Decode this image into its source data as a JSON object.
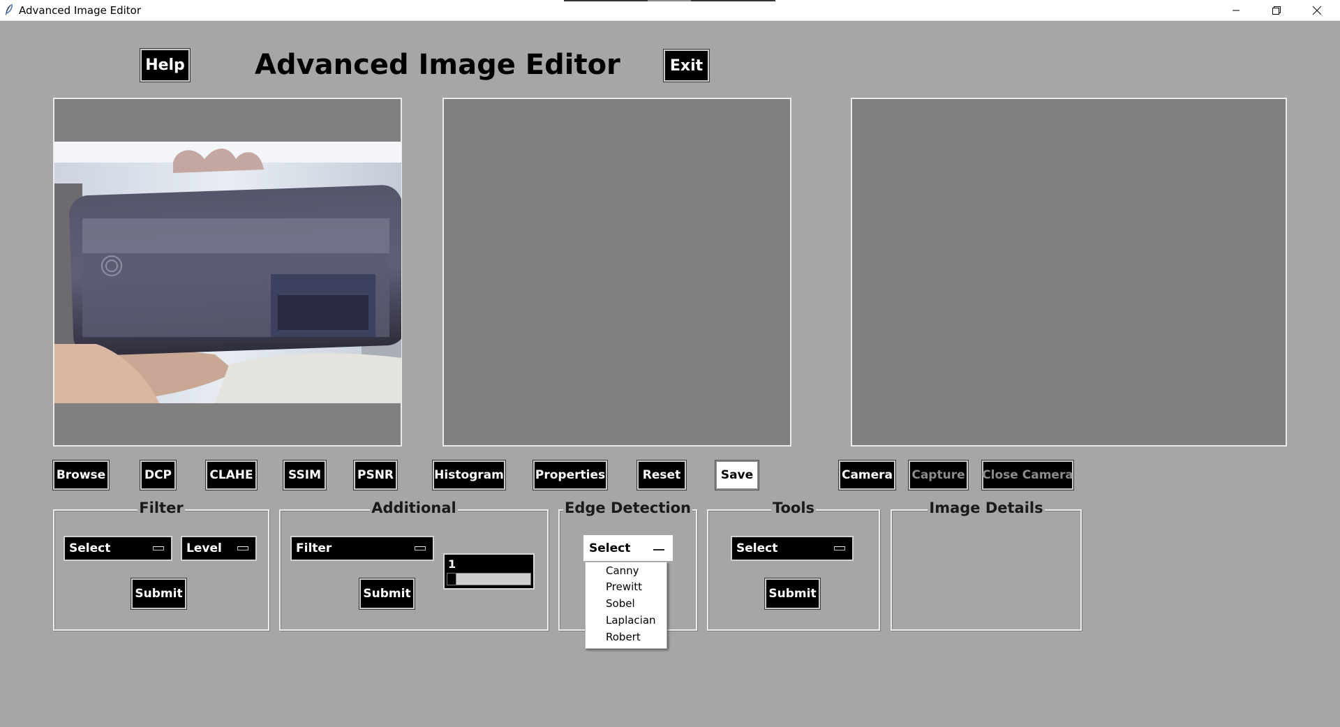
{
  "window": {
    "title": "Advanced Image Editor",
    "controls": [
      "minimize-icon",
      "restore-icon",
      "close-icon"
    ]
  },
  "header": {
    "help_label": "Help",
    "title": "Advanced Image Editor",
    "exit_label": "Exit"
  },
  "toolbar": {
    "browse": "Browse",
    "dcp": "DCP",
    "clahe": "CLAHE",
    "ssim": "SSIM",
    "psnr": "PSNR",
    "histogram": "Histogram",
    "properties": "Properties",
    "reset": "Reset",
    "save": "Save",
    "camera": "Camera",
    "capture": "Capture",
    "close_camera": "Close Camera"
  },
  "filter": {
    "legend": "Filter",
    "select_value": "Select",
    "level_value": "Level",
    "submit_label": "Submit"
  },
  "additional": {
    "legend": "Additional",
    "filter_value": "Filter",
    "submit_label": "Submit",
    "scale_value": "1"
  },
  "edge_detection": {
    "legend": "Edge Detection",
    "select_value": "Select",
    "options": [
      "Canny",
      "Prewitt",
      "Sobel",
      "Laplacian",
      "Robert"
    ]
  },
  "tools": {
    "legend": "Tools",
    "select_value": "Select",
    "submit_label": "Submit"
  },
  "image_details": {
    "legend": "Image Details"
  },
  "colors": {
    "background": "#a6a6a6",
    "panel": "#808080",
    "button": "#000000",
    "button_text": "#ffffff"
  }
}
